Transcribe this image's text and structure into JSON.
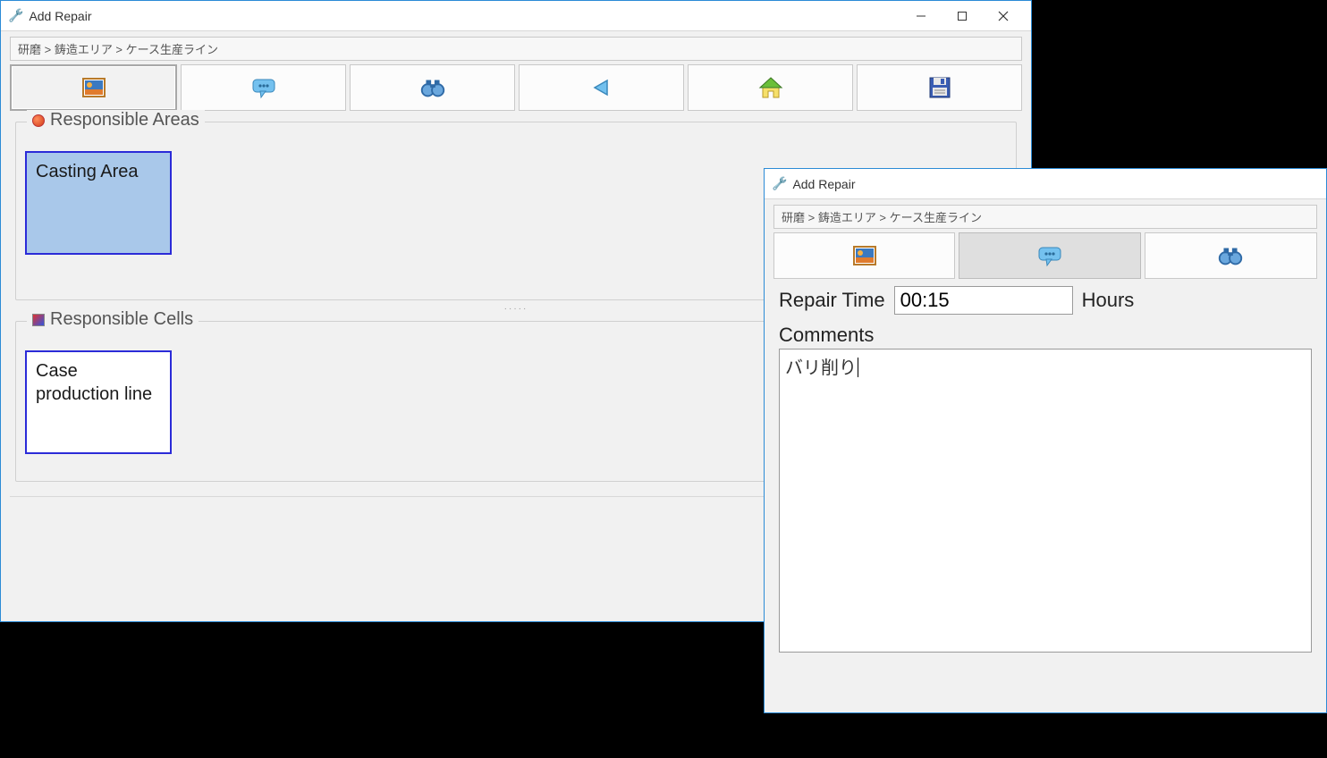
{
  "win1": {
    "title": "Add Repair",
    "breadcrumb": "研磨 > 鋳造エリア > ケース生産ライン",
    "groups": {
      "areas_label": "Responsible Areas",
      "cells_label": "Responsible Cells"
    },
    "tiles": {
      "area1": "Casting Area",
      "cell1": "Case production line"
    }
  },
  "win2": {
    "title": "Add Repair",
    "breadcrumb": "研磨 > 鋳造エリア > ケース生産ライン",
    "labels": {
      "repair_time": "Repair Time",
      "hours": "Hours",
      "comments": "Comments"
    },
    "values": {
      "repair_time": "00:15",
      "comments": "バリ削り"
    }
  }
}
